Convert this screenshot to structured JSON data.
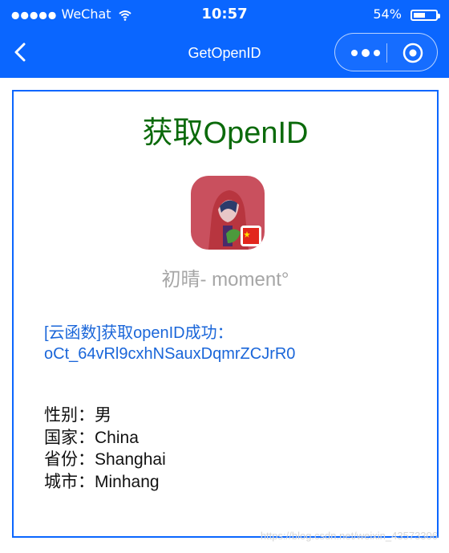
{
  "status_bar": {
    "carrier": "WeChat",
    "time": "10:57",
    "battery_percent": "54%",
    "battery_level": 0.54
  },
  "nav": {
    "title": "GetOpenID",
    "back_icon": "chevron-left-icon",
    "more_icon": "more-dots-icon",
    "close_icon": "target-circle-icon"
  },
  "content": {
    "heading": "获取OpenID",
    "nickname": "初晴- moment°",
    "cloud_result": {
      "line1": "[云函数]获取openID成功：",
      "line2": "oCt_64vRl9cxhNSauxDqmrZCJrR0"
    },
    "user_info": {
      "gender": "性别：男",
      "country": "国家：China",
      "province": "省份：Shanghai",
      "city": "城市：Minhang"
    }
  },
  "colors": {
    "brand_blue": "#0a66ff",
    "title_green": "#0b6a0b",
    "link_blue": "#1a66d9",
    "nickname_gray": "#a6a6a6"
  },
  "watermark": "https://blog.csdn.net/weixin_43573306"
}
